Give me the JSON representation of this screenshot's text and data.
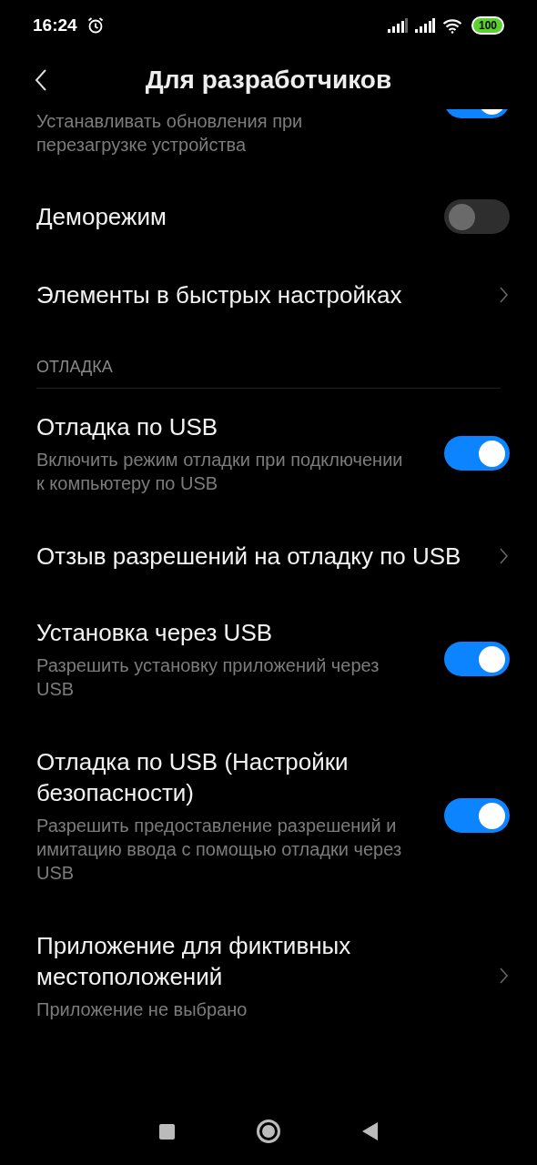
{
  "status_bar": {
    "time": "16:24",
    "battery": "100"
  },
  "header": {
    "title": "Для разработчиков"
  },
  "items": [
    {
      "kind": "toggle",
      "summary": "Устанавливать обновления при перезагрузке устройства",
      "on": true,
      "partial": true
    },
    {
      "kind": "toggle",
      "title": "Деморежим",
      "on": false
    },
    {
      "kind": "link",
      "title": "Элементы в быстрых настройках"
    },
    {
      "kind": "section",
      "title": "ОТЛАДКА"
    },
    {
      "kind": "toggle",
      "title": "Отладка по USB",
      "summary": "Включить режим отладки при подключении к компьютеру по USB",
      "on": true
    },
    {
      "kind": "link",
      "title": "Отзыв разрешений на отладку по USB"
    },
    {
      "kind": "toggle",
      "title": "Установка через USB",
      "summary": "Разрешить установку приложений через USB",
      "on": true
    },
    {
      "kind": "toggle",
      "title": "Отладка по USB (Настройки безопасности)",
      "summary": "Разрешить предоставление разрешений и имитацию ввода с помощью отладки через USB",
      "on": true
    },
    {
      "kind": "link",
      "title": "Приложение для фиктивных местоположений",
      "summary": "Приложение не выбрано"
    }
  ]
}
